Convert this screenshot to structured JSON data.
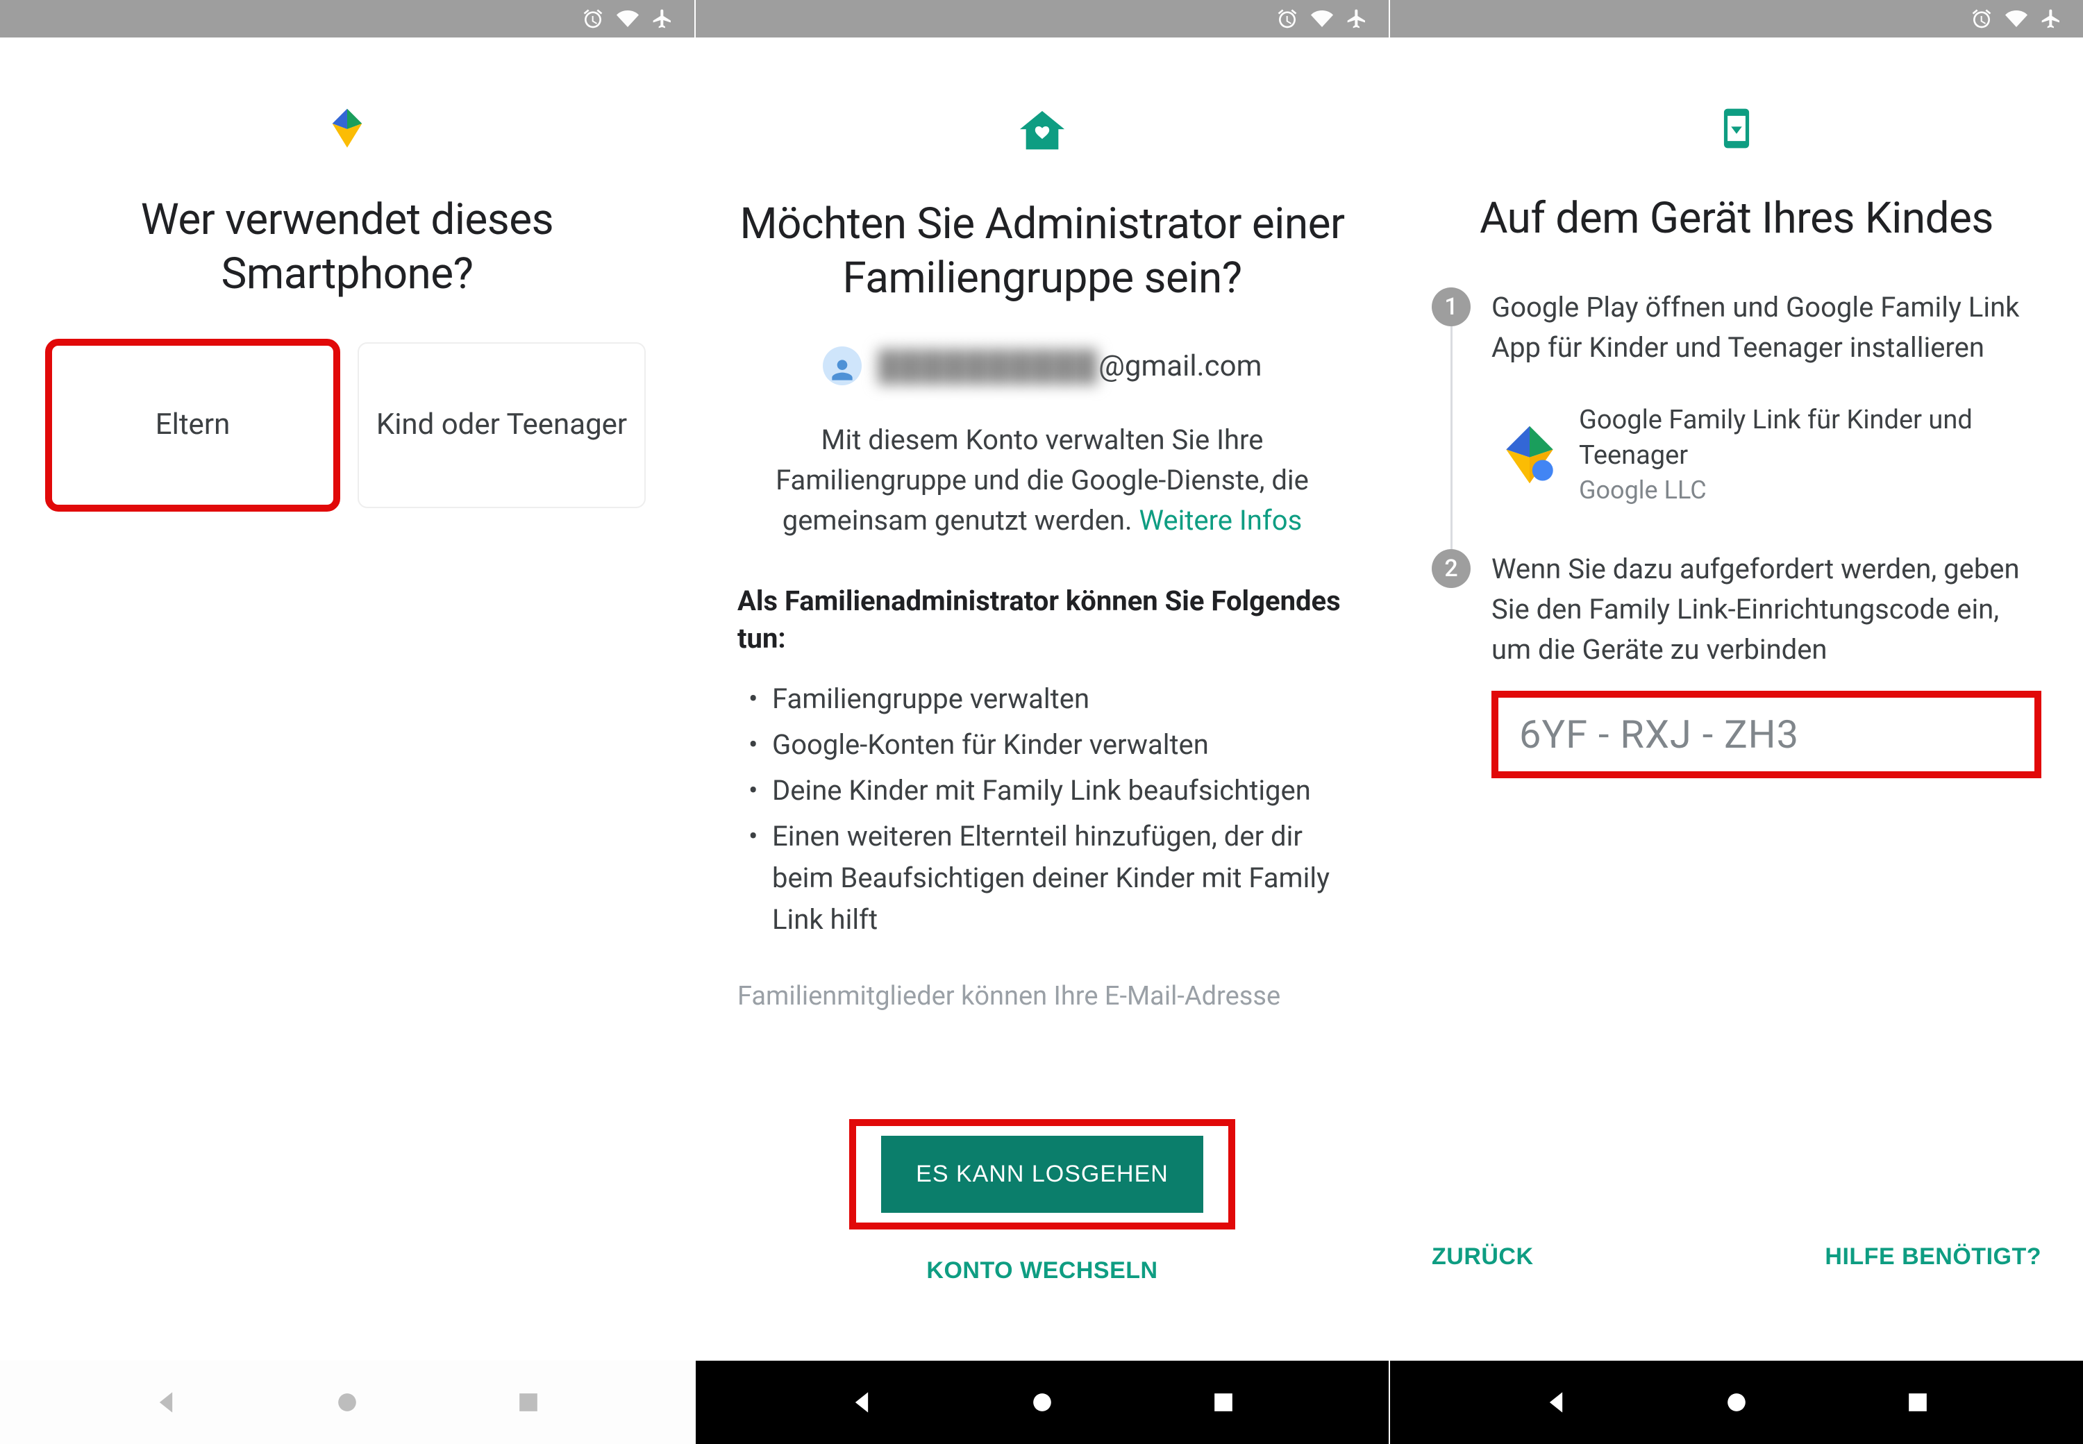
{
  "screen1": {
    "title": "Wer verwendet dieses Smartphone?",
    "option_parent": "Eltern",
    "option_child": "Kind oder Teenager"
  },
  "screen2": {
    "title": "Möchten Sie Administrator einer Familiengruppe sein?",
    "email_hidden": "██████████",
    "email_suffix": "@gmail.com",
    "desc_a": "Mit diesem Konto verwalten Sie Ihre Familiengruppe und die Google-Dienste, die gemeinsam genutzt werden. ",
    "desc_link": "Weitere Infos",
    "subhead": "Als Familienadministrator können Sie Folgendes tun:",
    "bullets": [
      "Familiengruppe verwalten",
      "Google-Konten für Kinder verwalten",
      "Deine Kinder mit Family Link beaufsichtigen",
      "Einen weiteren Elternteil hinzufügen, der dir beim Beaufsichtigen deiner Kinder mit Family Link hilft"
    ],
    "faded": "Familienmitglieder können Ihre E-Mail-Adresse",
    "primary_btn": "ES KANN LOSGEHEN",
    "secondary_btn": "KONTO WECHSELN"
  },
  "screen3": {
    "title": "Auf dem Gerät Ihres Kindes",
    "step1": "Google Play öffnen und Google Family Link App für Kinder und Teenager installieren",
    "app_name": "Google Family Link für Kinder und Teenager",
    "app_publisher": "Google LLC",
    "step2": "Wenn Sie dazu aufgefordert werden, geben Sie den Family Link-Einrichtungscode ein, um die Geräte zu verbinden",
    "code": "6YF - RXJ - ZH3",
    "back_btn": "ZURÜCK",
    "help_btn": "HILFE BENÖTIGT?"
  }
}
